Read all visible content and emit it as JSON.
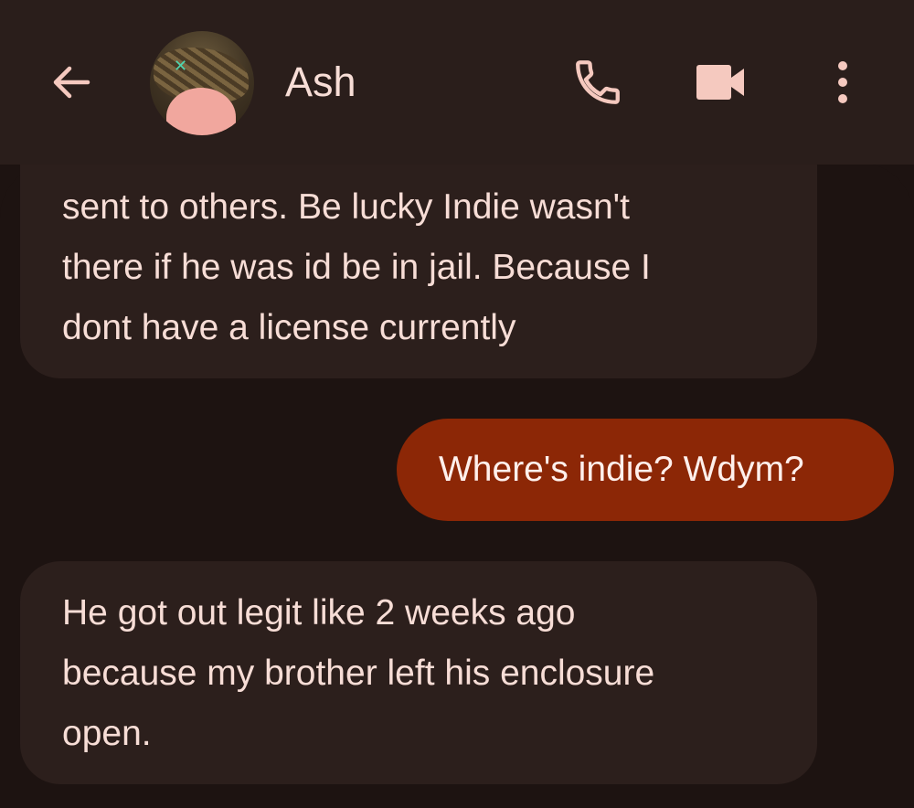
{
  "header": {
    "contact_name": "Ash",
    "back_icon": "arrow-left-icon",
    "call_icon": "phone-icon",
    "video_icon": "video-camera-icon",
    "more_icon": "more-vert-icon"
  },
  "colors": {
    "background": "#1d1311",
    "app_bar": "#2a1e1b",
    "incoming_bubble": "#2c1f1c",
    "outgoing_bubble": "#8c2706",
    "text": "#f7ddd6",
    "icon": "#f5c9bf"
  },
  "messages": [
    {
      "direction": "incoming",
      "lines": [
        "sent to others. Be lucky Indie wasn't",
        "there if he was id be in jail. Because I",
        "dont have a license currently"
      ]
    },
    {
      "direction": "outgoing",
      "lines": [
        "Where's indie? Wdym?"
      ]
    },
    {
      "direction": "incoming",
      "lines": [
        "He got out legit like 2 weeks ago",
        "because my brother left his enclosure",
        "open."
      ]
    }
  ]
}
